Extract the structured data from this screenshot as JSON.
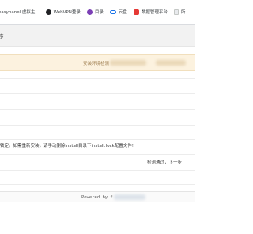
{
  "bookmarks": [
    {
      "label": "easypanel 虚拟主...",
      "icon": "none"
    },
    {
      "label": "WebVPN登录",
      "icon": "globe-icon"
    },
    {
      "label": "目录",
      "icon": "purple-circle-icon"
    },
    {
      "label": "云盘",
      "icon": "cloud-icon"
    },
    {
      "label": "数据管理平台",
      "icon": "red-square-icon"
    },
    {
      "label": "所",
      "icon": "page-icon"
    }
  ],
  "header": {
    "title": "序"
  },
  "banner": {
    "text": "安装环境检测"
  },
  "notice": {
    "text": "锁定。如需重新安装，请手动删除install目录下install.lock配置文件!"
  },
  "status": {
    "text": "检测通过，下一步"
  },
  "footer": {
    "text": "Powered by f"
  },
  "colors": {
    "banner_bg": "#fcf2df",
    "banner_text": "#9b7a4a",
    "title_bg": "#f2f2f2"
  }
}
